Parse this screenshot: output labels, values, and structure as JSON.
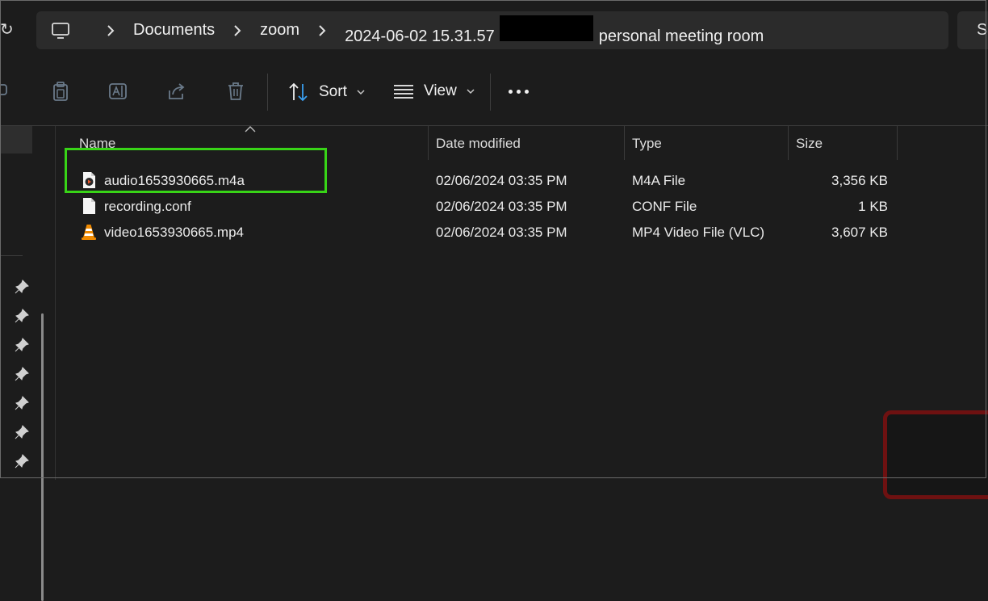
{
  "window": {
    "left_glyph": "↻",
    "address": {
      "home_icon": "computer-icon",
      "crumbs": [
        "Documents",
        "zoom",
        "2024-06-02 15.31.57",
        "personal meeting room"
      ],
      "search_text": "Se"
    }
  },
  "toolbar": {
    "icons": [
      "share-left-icon",
      "paste-icon",
      "rename-icon",
      "share-icon",
      "delete-icon"
    ],
    "sort_label": "Sort",
    "view_label": "View",
    "more_icon": "more-icon"
  },
  "nav": {
    "pins": 7
  },
  "file_list": {
    "columns": {
      "name": "Name",
      "date": "Date modified",
      "type": "Type",
      "size": "Size"
    },
    "rows": [
      {
        "icon": "audio-file-icon",
        "name": "audio1653930665.m4a",
        "date": "02/06/2024 03:35 PM",
        "type": "M4A File",
        "size": "3,356 KB"
      },
      {
        "icon": "document-icon",
        "name": "recording.conf",
        "date": "02/06/2024 03:35 PM",
        "type": "CONF File",
        "size": "1 KB"
      },
      {
        "icon": "vlc-icon",
        "name": "video1653930665.mp4",
        "date": "02/06/2024 03:35 PM",
        "type": "MP4 Video File (VLC)",
        "size": "3,607 KB"
      }
    ]
  },
  "colors": {
    "highlight": "#38d417",
    "background": "#1c1c1c",
    "addressbar": "#2b2b2b",
    "vlc_orange": "#f08a00"
  }
}
